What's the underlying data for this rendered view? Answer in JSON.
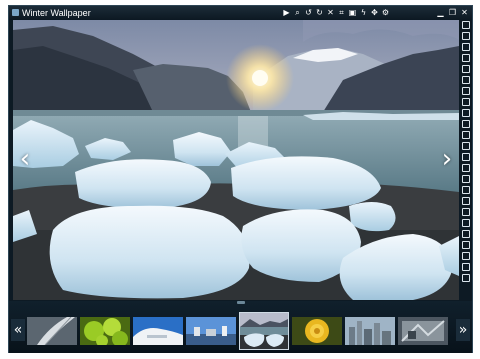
{
  "window": {
    "title": "Winter Wallpaper"
  },
  "toolbar": {
    "icons": [
      "play-icon",
      "zoom-in-icon",
      "rotate-left-icon",
      "rotate-right-icon",
      "delete-icon",
      "crop-icon",
      "resize-icon",
      "effects-icon",
      "pan-icon",
      "settings-icon"
    ]
  },
  "window_controls": {
    "icons": [
      "minimize-icon",
      "restore-icon",
      "close-icon"
    ]
  },
  "viewer": {
    "prev_glyph": "‹",
    "next_glyph": "›"
  },
  "filmstrip": {
    "prev_glyph": "«",
    "next_glyph": "»",
    "selected_index": 4,
    "thumbnails": [
      "feather",
      "green-balls",
      "white-building",
      "blue-sky",
      "winter-lake",
      "yellow-rose",
      "city-skyline",
      "abstract-pattern"
    ]
  },
  "colors": {
    "window_bg": "#0d1a24",
    "accent": "#cfdbe4"
  }
}
